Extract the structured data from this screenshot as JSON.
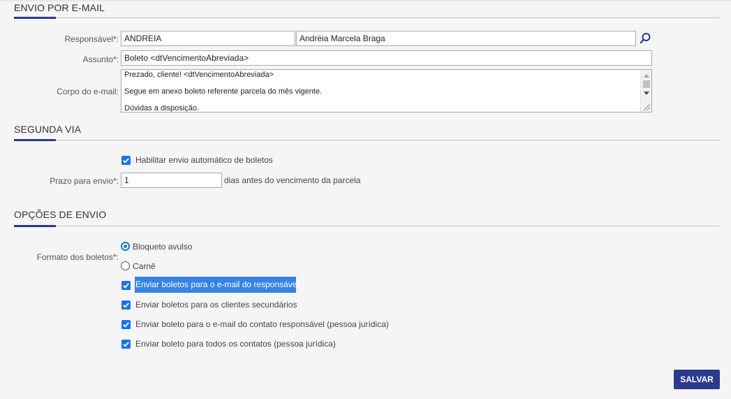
{
  "sections": {
    "email": "ENVIO POR E-MAIL",
    "segunda_via": "SEGUNDA VIA",
    "opcoes": "OPÇÕES DE ENVIO"
  },
  "email": {
    "responsavel_label": "Responsável*:",
    "responsavel_code": "ANDREIA",
    "responsavel_name": "Andréia Marcela Braga",
    "assunto_label": "Assunto*:",
    "assunto_value": "Boleto <dtVencimentoAbreviada>",
    "corpo_label": "Corpo do e-mail:",
    "corpo_lines": [
      "Prezado, cliente! <dtVencimentoAbreviada>",
      "",
      "Segue em anexo boleto referente parcela do mês vigente.",
      "",
      "Dúvidas a disposição."
    ]
  },
  "segunda_via": {
    "habilitar_label": "Habilitar envio automático de boletos",
    "habilitar_checked": true,
    "prazo_label": "Prazo para envio*:",
    "prazo_value": "1",
    "prazo_suffix": "dias antes do vencimento da parcela"
  },
  "opcoes": {
    "formato_label": "Formato dos boletos*:",
    "formato_options": [
      "Bloqueto avulso",
      "Carnê"
    ],
    "formato_selected": "Bloqueto avulso",
    "checkboxes": [
      {
        "label": "Enviar boletos para o e-mail do responsável",
        "checked": true
      },
      {
        "label": "Enviar boletos para os clientes secundários",
        "checked": true
      },
      {
        "label": "Enviar boleto para o e-mail do contato responsável (pessoa jurídica)",
        "checked": true
      },
      {
        "label": "Enviar boleto para todos os contatos (pessoa jurídica)",
        "checked": true
      }
    ]
  },
  "actions": {
    "save_label": "SALVAR"
  },
  "colors": {
    "accent": "#2b3a8f",
    "check": "#1a73e8",
    "selection": "#3584e4"
  }
}
